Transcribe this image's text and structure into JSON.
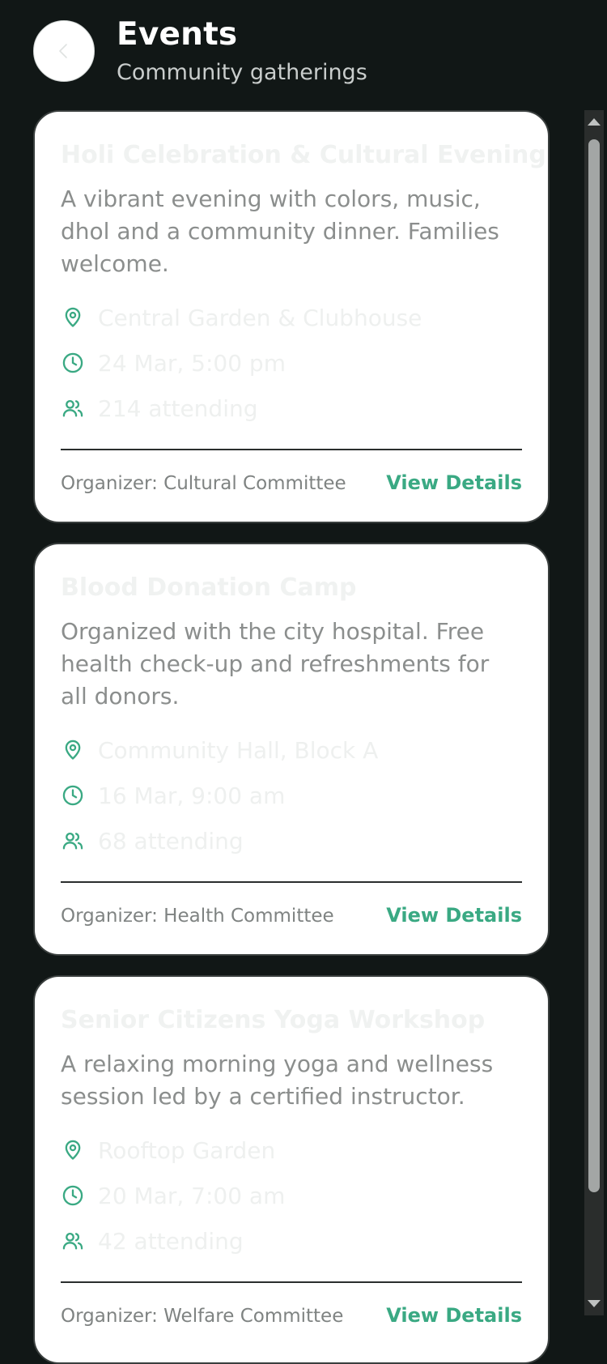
{
  "header": {
    "title": "Events",
    "subtitle": "Community gatherings",
    "back_icon": "chevron-left-icon"
  },
  "colors": {
    "background": "#111716",
    "card": "#ffffff",
    "accent": "#3aa983",
    "muted_text": "#8b8e8d"
  },
  "events": [
    {
      "title": "Holi Celebration & Cultural Evening",
      "description": "A vibrant evening with colors, music, dhol and a community dinner. Families welcome.",
      "location": "Central Garden & Clubhouse",
      "datetime": "24 Mar, 5:00 pm",
      "attending": "214 attending",
      "organizer": "Organizer: Cultural Committee",
      "action": "View Details"
    },
    {
      "title": "Blood Donation Camp",
      "description": "Organized with the city hospital. Free health check-up and refreshments for all donors.",
      "location": "Community Hall, Block A",
      "datetime": "16 Mar, 9:00 am",
      "attending": "68 attending",
      "organizer": "Organizer: Health Committee",
      "action": "View Details"
    },
    {
      "title": "Senior Citizens Yoga Workshop",
      "description": "A relaxing morning yoga and wellness session led by a certified instructor.",
      "location": "Rooftop Garden",
      "datetime": "20 Mar, 7:00 am",
      "attending": "42 attending",
      "organizer": "Organizer: Welfare Committee",
      "action": "View Details"
    }
  ]
}
